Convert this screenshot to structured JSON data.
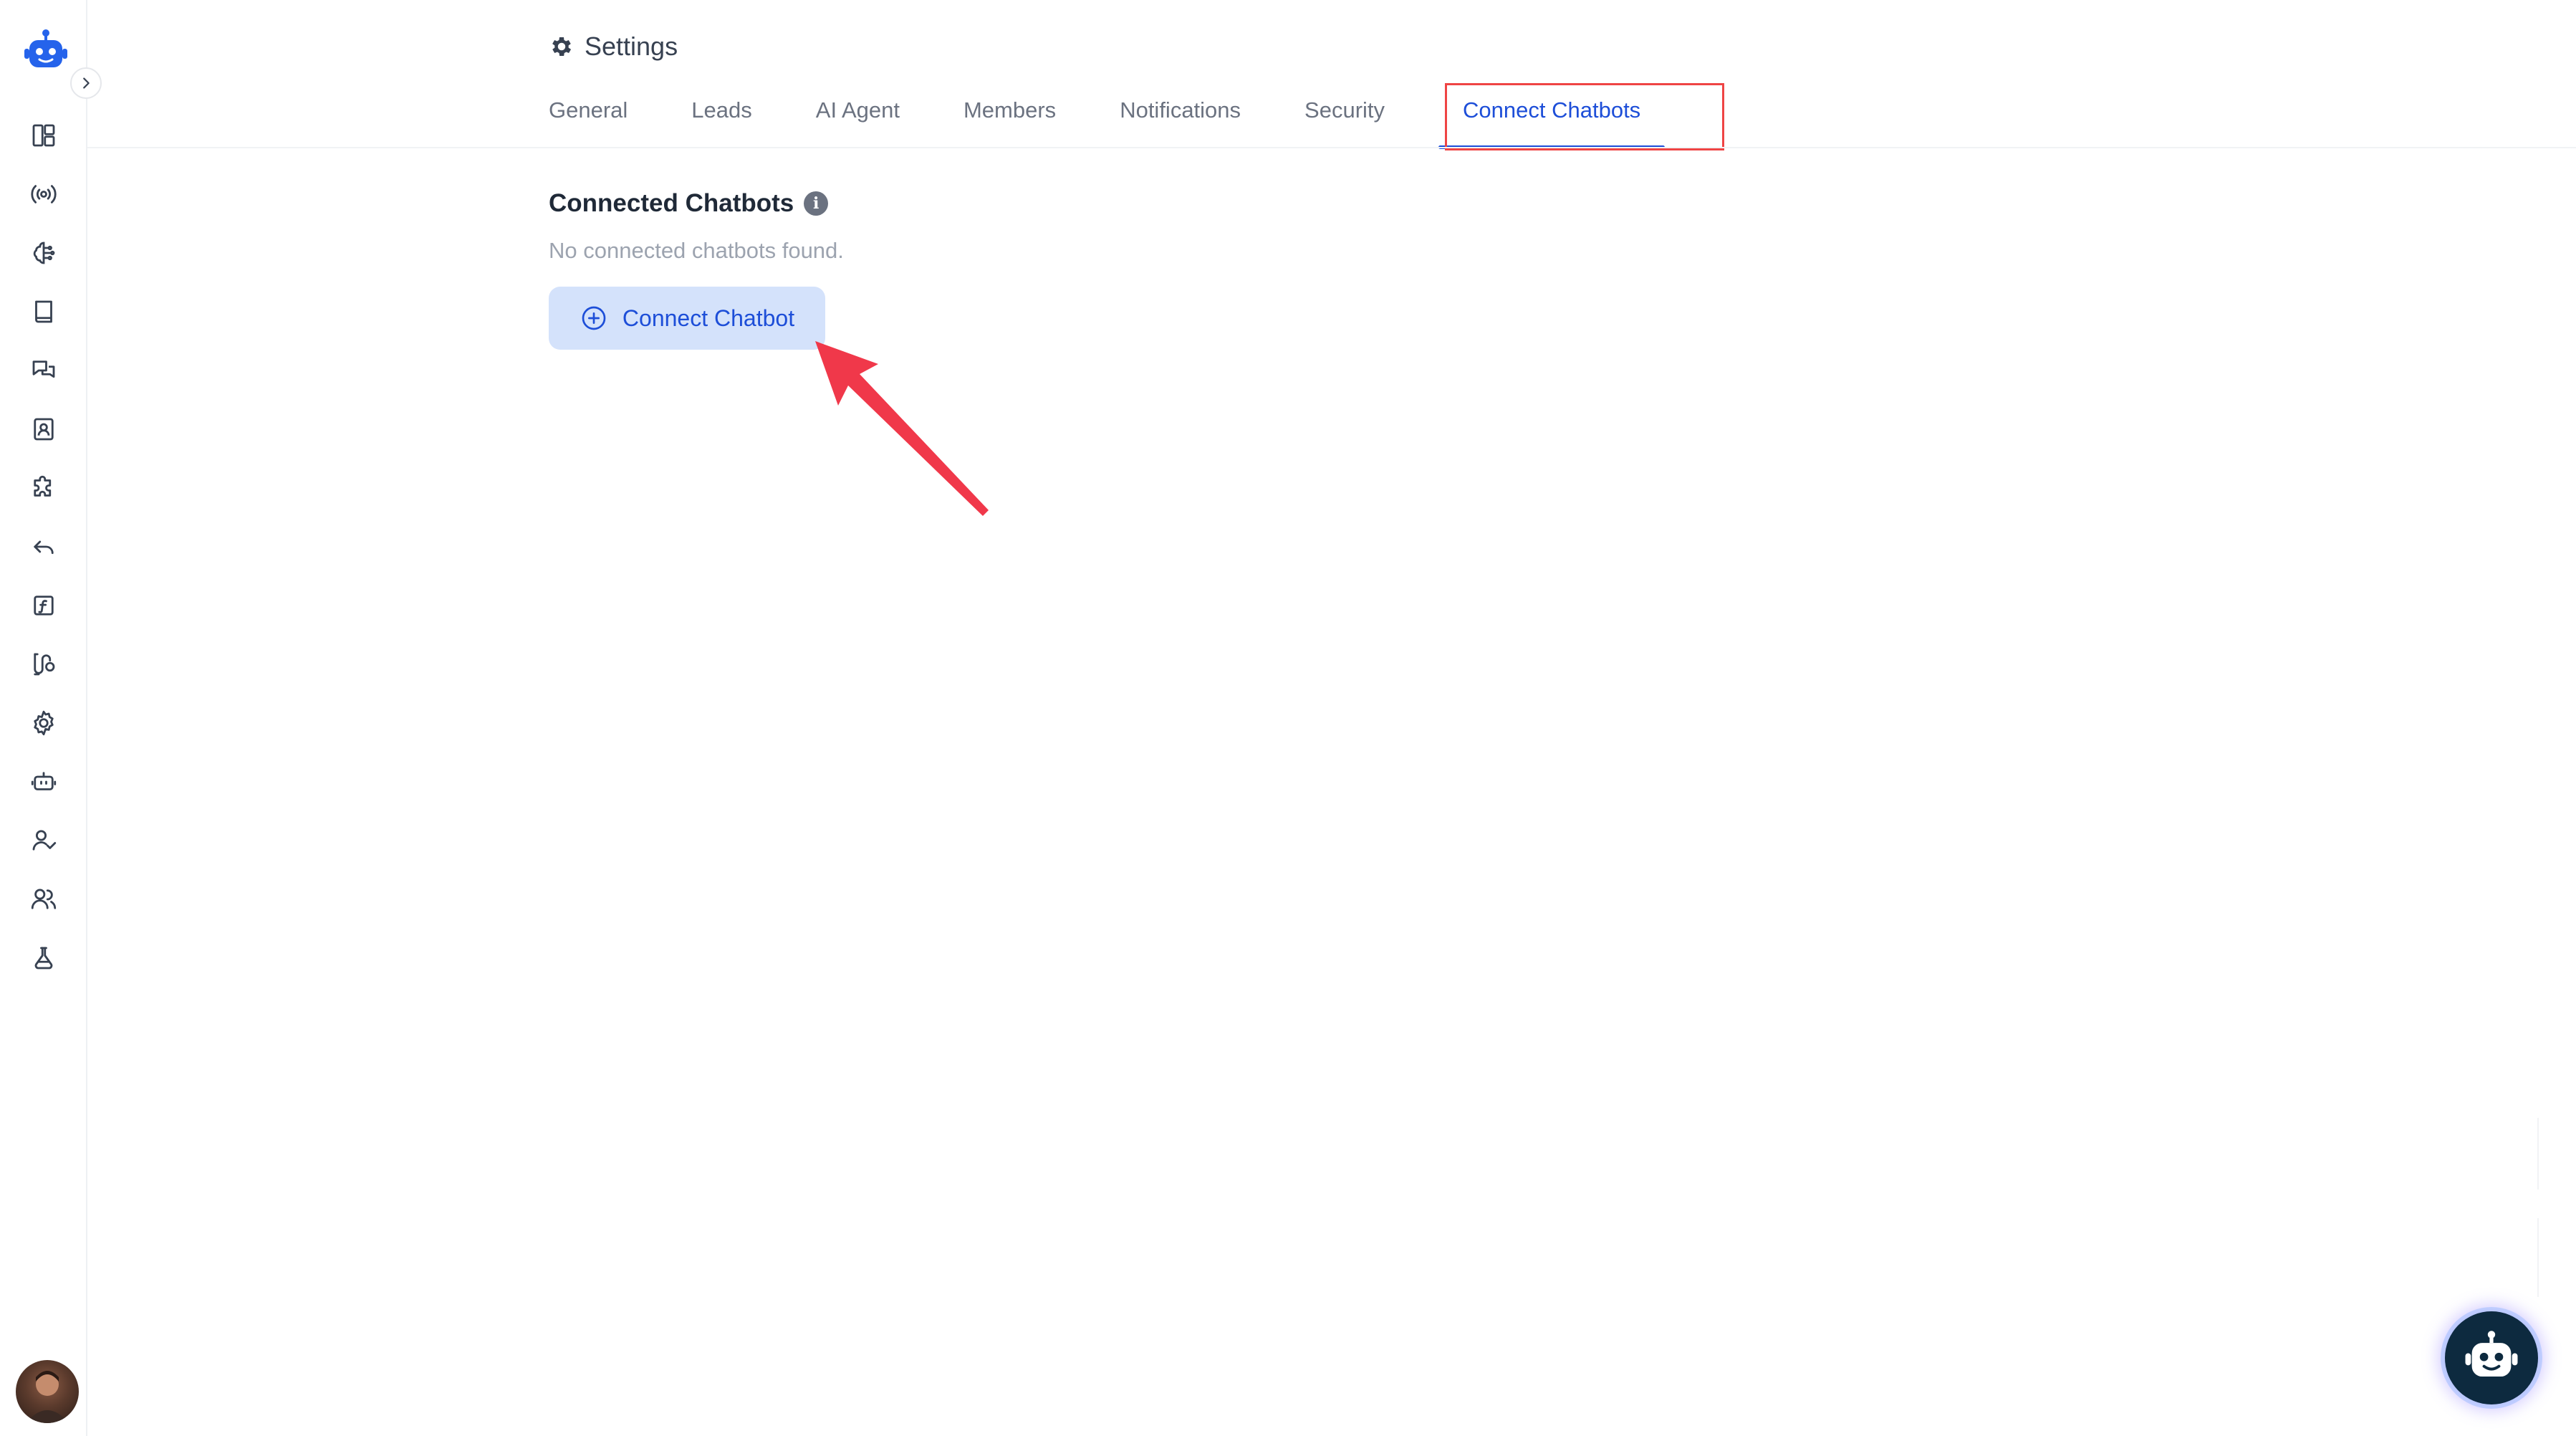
{
  "header": {
    "title": "Settings",
    "icon": "gear-icon"
  },
  "tabs": [
    {
      "label": "General",
      "active": false
    },
    {
      "label": "Leads",
      "active": false
    },
    {
      "label": "AI Agent",
      "active": false
    },
    {
      "label": "Members",
      "active": false
    },
    {
      "label": "Notifications",
      "active": false
    },
    {
      "label": "Security",
      "active": false
    },
    {
      "label": "Connect Chatbots",
      "active": true
    }
  ],
  "section": {
    "title": "Connected Chatbots",
    "info_icon_glyph": "i",
    "empty_text": "No connected chatbots found.",
    "button_label": "Connect Chatbot"
  },
  "sidebar": {
    "items": [
      {
        "icon": "layout-icon"
      },
      {
        "icon": "broadcast-icon"
      },
      {
        "icon": "brain-icon"
      },
      {
        "icon": "book-icon"
      },
      {
        "icon": "chat-bubbles-icon"
      },
      {
        "icon": "contact-card-icon"
      },
      {
        "icon": "puzzle-icon"
      },
      {
        "icon": "reply-icon"
      },
      {
        "icon": "function-icon"
      },
      {
        "icon": "workflow-icon"
      },
      {
        "icon": "gear-icon"
      },
      {
        "icon": "bot-icon"
      },
      {
        "icon": "user-check-icon"
      },
      {
        "icon": "users-icon"
      },
      {
        "icon": "flask-icon"
      }
    ]
  },
  "colors": {
    "accent": "#1d4ed8",
    "button_bg": "#d4e2fb",
    "highlight": "#ef4444",
    "arrow": "#f0384a",
    "muted_text": "#9ca3af"
  }
}
